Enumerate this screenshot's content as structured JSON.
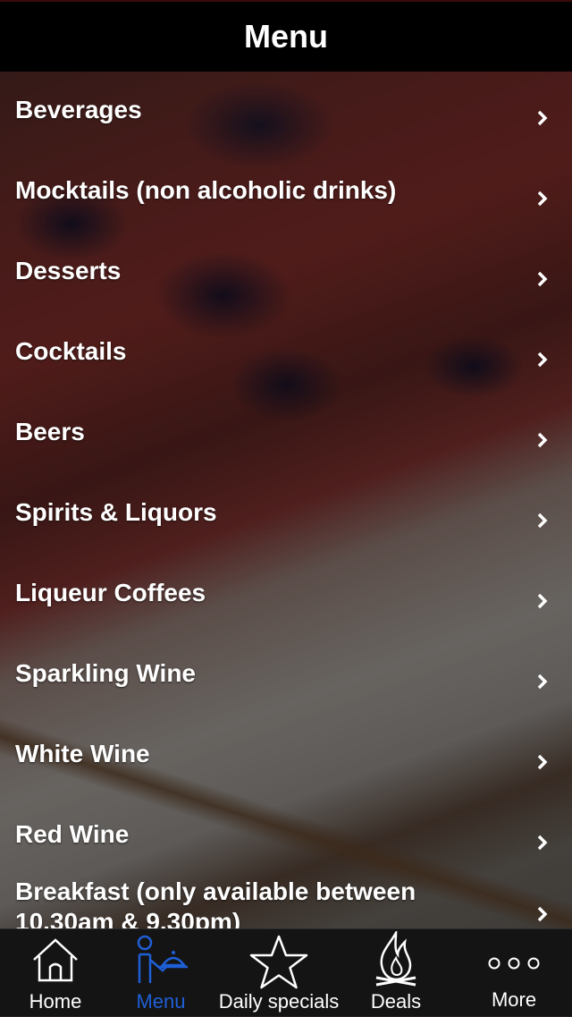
{
  "header": {
    "title": "Menu"
  },
  "menu": {
    "items": [
      {
        "label": "Beverages"
      },
      {
        "label": "Mocktails (non alcoholic drinks)"
      },
      {
        "label": "Desserts"
      },
      {
        "label": "Cocktails"
      },
      {
        "label": "Beers"
      },
      {
        "label": "Spirits & Liquors"
      },
      {
        "label": "Liqueur Coffees"
      },
      {
        "label": "Sparkling Wine"
      },
      {
        "label": "White Wine"
      },
      {
        "label": "Red Wine"
      },
      {
        "label": "Breakfast (only available between 10.30am & 9.30pm)"
      }
    ]
  },
  "tabbar": {
    "tabs": [
      {
        "label": "Home",
        "icon": "home-icon",
        "active": false
      },
      {
        "label": "Menu",
        "icon": "waiter-icon",
        "active": true
      },
      {
        "label": "Daily specials",
        "icon": "star-icon",
        "active": false
      },
      {
        "label": "Deals",
        "icon": "flame-icon",
        "active": false
      },
      {
        "label": "More",
        "icon": "more-icon",
        "active": false
      }
    ]
  },
  "colors": {
    "accent": "#1f5fd6",
    "header_bg": "#000000",
    "tabbar_bg": "#141414"
  }
}
